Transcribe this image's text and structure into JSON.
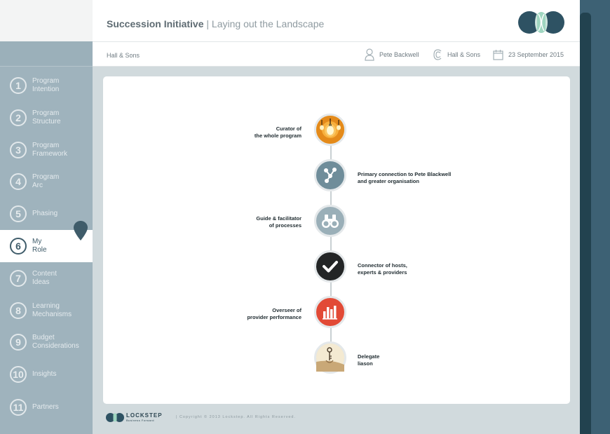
{
  "header": {
    "title_bold": "Succession Initiative",
    "title_separator": " | ",
    "title_rest": "Laying out the Landscape"
  },
  "subheader": {
    "company": "Hall  & Sons",
    "user": "Pete Backwell",
    "client": "Hall & Sons",
    "date": "23 September 2015"
  },
  "sidebar": {
    "items": [
      {
        "num": "1",
        "label": "Program\nIntention"
      },
      {
        "num": "2",
        "label": "Program\nStructure"
      },
      {
        "num": "3",
        "label": "Program\nFramework"
      },
      {
        "num": "4",
        "label": "Program\nArc"
      },
      {
        "num": "5",
        "label": "Phasing"
      },
      {
        "num": "6",
        "label": "My\nRole"
      },
      {
        "num": "7",
        "label": "Content\nIdeas"
      },
      {
        "num": "8",
        "label": "Learning\nMechanisms"
      },
      {
        "num": "9",
        "label": "Budget\nConsiderations"
      },
      {
        "num": "10",
        "label": "Insights"
      },
      {
        "num": "11",
        "label": "Partners"
      }
    ],
    "active_index": 5
  },
  "roles": [
    {
      "text": "Curator of\nthe whole program",
      "side": "left",
      "icon": "lightbulb-icon",
      "color": "#f2a22a"
    },
    {
      "text": "Primary connection to Pete Blackwell\nand greater organisation",
      "side": "right",
      "icon": "network-icon",
      "color": "#6f8d9a"
    },
    {
      "text": "Guide & facilitator\nof processes",
      "side": "left",
      "icon": "binoculars-icon",
      "color": "#9aafb8"
    },
    {
      "text": "Connector of hosts,\nexperts & providers",
      "side": "right",
      "icon": "checkmark-icon",
      "color": "#232526"
    },
    {
      "text": "Overseer of\nprovider performance",
      "side": "left",
      "icon": "bar-chart-icon",
      "color": "#e24a36"
    },
    {
      "text": "Delegate\nliason",
      "side": "right",
      "icon": "key-icon",
      "color": "#e9dcc0"
    }
  ],
  "footer": {
    "brand": "LOCKSTEP",
    "tagline": "Business Forward",
    "copyright": "| Copyright © 2013 Lockstep. All Rights Reserved."
  }
}
